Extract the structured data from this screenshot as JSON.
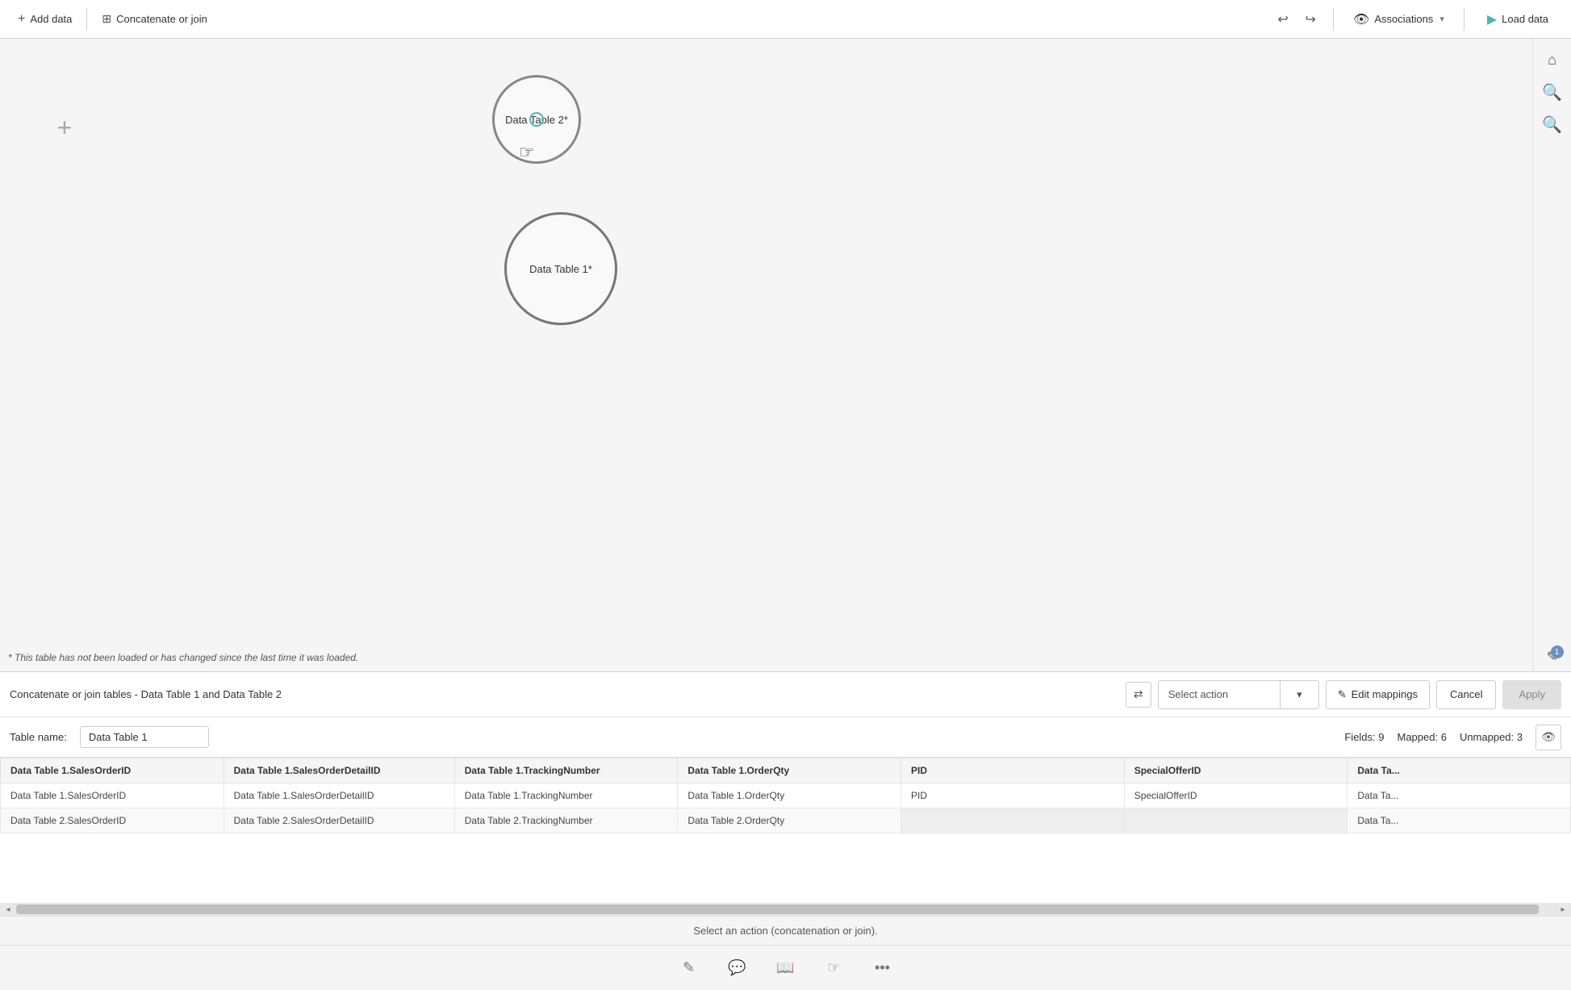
{
  "toolbar": {
    "add_data_label": "Add data",
    "concatenate_join_label": "Concatenate or join",
    "undo_icon": "↩",
    "redo_icon": "↪",
    "associations_label": "Associations",
    "associations_dropdown_icon": "▾",
    "load_data_icon": "▶",
    "load_data_label": "Load data"
  },
  "right_sidebar": {
    "home_icon": "⌂",
    "zoom_in_icon": "+",
    "zoom_out_icon": "−",
    "pencil_icon": "✎",
    "badge_count": "1"
  },
  "canvas": {
    "plus_icon": "+",
    "node1_label": "Data Table 2*",
    "node2_label": "Data Table 1*",
    "note_text": "* This table has not been loaded or has changed since the last time it was loaded."
  },
  "action_bar": {
    "title": "Concatenate or join tables - Data Table 1 and Data Table 2",
    "swap_icon": "⇄",
    "select_action_placeholder": "Select action",
    "dropdown_arrow": "▾",
    "edit_icon": "✎",
    "edit_mappings_label": "Edit mappings",
    "cancel_label": "Cancel",
    "apply_label": "Apply"
  },
  "table_name_row": {
    "label": "Table name:",
    "value": "Data Table 1",
    "fields_label": "Fields: 9",
    "mapped_label": "Mapped: 6",
    "unmapped_label": "Unmapped: 3",
    "eye_icon": "👁"
  },
  "table": {
    "columns": [
      "Data Table 1.SalesOrderID",
      "Data Table 1.SalesOrderDetailID",
      "Data Table 1.TrackingNumber",
      "Data Table 1.OrderQty",
      "PID",
      "SpecialOfferID",
      "Data Ta..."
    ],
    "rows": [
      [
        "Data Table 1.SalesOrderID",
        "Data Table 1.SalesOrderDetailID",
        "Data Table 1.TrackingNumber",
        "Data Table 1.OrderQty",
        "PID",
        "SpecialOfferID",
        "Data Ta..."
      ],
      [
        "Data Table 2.SalesOrderID",
        "Data Table 2.SalesOrderDetailID",
        "Data Table 2.TrackingNumber",
        "Data Table 2.OrderQty",
        "",
        "",
        "Data Ta..."
      ]
    ]
  },
  "status_bar": {
    "text": "Select an action (concatenation or join)."
  },
  "bottom_icons": {
    "pencil_icon": "✎",
    "chat_icon": "💬",
    "book_icon": "📖",
    "pointer_icon": "👆",
    "more_icon": "•••"
  }
}
